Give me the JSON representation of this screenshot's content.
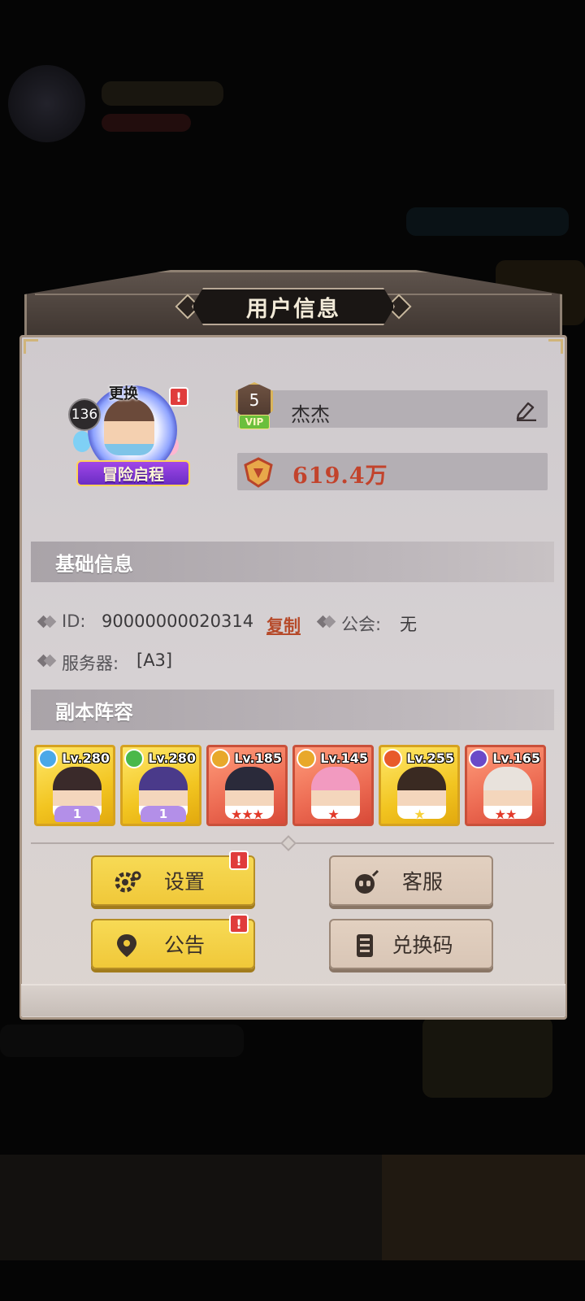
{
  "dialog": {
    "title": "用户信息"
  },
  "profile": {
    "level": "136",
    "change_label": "更换",
    "frame_ribbon": "冒险启程",
    "vip_level": "5",
    "vip_tag": "VIP",
    "name": "杰杰",
    "power": "619.4万"
  },
  "basic_info": {
    "header": "基础信息",
    "id_label": "ID:",
    "id_value": "90000000020314",
    "copy_label": "复制",
    "guild_label": "公会:",
    "guild_value": "无",
    "server_label": "服务器:",
    "server_value": "[A3]"
  },
  "lineup": {
    "header": "副本阵容",
    "heroes": [
      {
        "level": "Lv.280",
        "frame": "gold",
        "element_color": "#4aa8e8",
        "badge": "1"
      },
      {
        "level": "Lv.280",
        "frame": "gold",
        "element_color": "#4ab84a",
        "badge": "1"
      },
      {
        "level": "Lv.185",
        "frame": "red",
        "element_color": "#e8a82a",
        "stars": "★★★"
      },
      {
        "level": "Lv.145",
        "frame": "red",
        "element_color": "#e8a82a",
        "stars": "★"
      },
      {
        "level": "Lv.255",
        "frame": "gold",
        "element_color": "#e85a2a",
        "stars": "★"
      },
      {
        "level": "Lv.165",
        "frame": "red",
        "element_color": "#6a4ac8",
        "stars": "★★"
      }
    ]
  },
  "buttons": {
    "settings": "设置",
    "support": "客服",
    "notice": "公告",
    "redeem": "兑换码"
  },
  "alerts": {
    "mark": "!"
  },
  "colors": {
    "power_text": "#c2432c",
    "copy_link": "#b64a2a",
    "yellow_button": "#f0c839",
    "tan_button": "#d9c6b6",
    "alert_red": "#e03c3c"
  }
}
